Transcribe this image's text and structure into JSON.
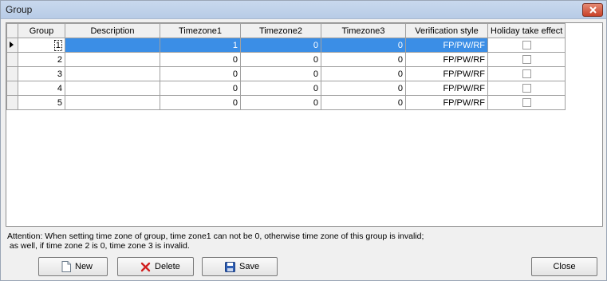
{
  "window": {
    "title": "Group"
  },
  "grid": {
    "columns": [
      "Group",
      "Description",
      "Timezone1",
      "Timezone2",
      "Timezone3",
      "Verification style",
      "Holiday take effect"
    ],
    "rows": [
      {
        "group": "1",
        "description": "",
        "tz1": "1",
        "tz2": "0",
        "tz3": "0",
        "verify": "FP/PW/RF",
        "holiday": false,
        "selected": true
      },
      {
        "group": "2",
        "description": "",
        "tz1": "0",
        "tz2": "0",
        "tz3": "0",
        "verify": "FP/PW/RF",
        "holiday": false,
        "selected": false
      },
      {
        "group": "3",
        "description": "",
        "tz1": "0",
        "tz2": "0",
        "tz3": "0",
        "verify": "FP/PW/RF",
        "holiday": false,
        "selected": false
      },
      {
        "group": "4",
        "description": "",
        "tz1": "0",
        "tz2": "0",
        "tz3": "0",
        "verify": "FP/PW/RF",
        "holiday": false,
        "selected": false
      },
      {
        "group": "5",
        "description": "",
        "tz1": "0",
        "tz2": "0",
        "tz3": "0",
        "verify": "FP/PW/RF",
        "holiday": false,
        "selected": false
      }
    ]
  },
  "attention": {
    "line1": "Attention: When setting time zone of group, time zone1 can not be 0, otherwise time zone of this group is invalid;",
    "line2": " as well, if time zone 2 is 0, time zone 3 is invalid."
  },
  "buttons": {
    "new": "New",
    "delete": "Delete",
    "save": "Save",
    "close": "Close"
  },
  "icons": {
    "window_close": "close-x-icon",
    "new": "new-document-icon",
    "delete": "red-x-icon",
    "save": "floppy-disk-icon"
  },
  "colors": {
    "selection": "#3b8ee6",
    "delete_icon": "#d11f1f",
    "save_icon": "#2f5fb4"
  }
}
